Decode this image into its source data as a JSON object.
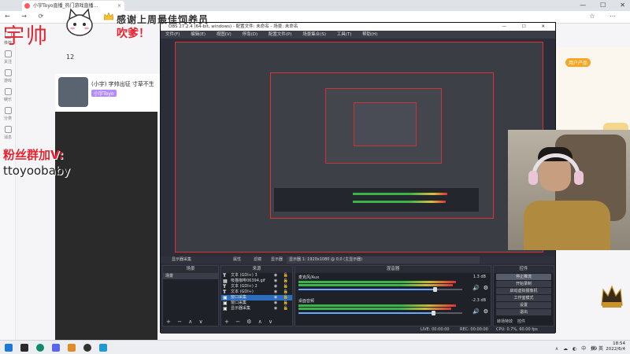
{
  "browser": {
    "tab_title": "小宇Toyo直播_热门游戏直播...",
    "tab_close": "×",
    "window_controls": [
      "—",
      "☐",
      "✕"
    ],
    "nav_glyphs": "← → ⟳",
    "toolbar_glyphs": "☆ ⋯"
  },
  "left_rail": [
    "推荐",
    "关注",
    "游戏",
    "娱乐",
    "分类",
    "消息"
  ],
  "stream": {
    "title": "(小宇) 字帅出征 寸草不生",
    "tag": "小宇Toyo",
    "viewer_count": "12"
  },
  "right_panel": {
    "tag": "用户产品"
  },
  "overlay": {
    "banner_text": "感谢上周最佳饲养员",
    "streamer_name": "宇帅",
    "blow_text": "吹爹！",
    "fans_line1": "粉丝群加V:",
    "fans_line2": "ttoyoobaby"
  },
  "obs": {
    "title": "OBS 27.2.4 (64-bit, windows) - 配置文件: 未命名 - 场景: 未命名",
    "window_buttons": "— ☐ ✕",
    "menu": [
      "文件(F)",
      "编辑(E)",
      "视图(V)",
      "停靠(D)",
      "配置文件(P)",
      "场景集合(S)",
      "工具(T)",
      "帮助(H)"
    ],
    "source_bar": {
      "source_label": "显示器采集",
      "properties": "属性",
      "filters": "滤镜",
      "display": "显示器",
      "display_value": "显示器 1: 1920x1080 @ 0,0 (主显示器)"
    },
    "scenes": {
      "header": "场景",
      "items": [
        "场景"
      ],
      "footer": "+ − ∧ ∨"
    },
    "sources": {
      "header": "来源",
      "items": [
        {
          "type": "T",
          "name": "文本 (GDI+) 3",
          "visibility": "◉ 🔓"
        },
        {
          "type": "▦",
          "name": "吸猫咖啡06394.gif",
          "visibility": "◉ 🔓"
        },
        {
          "type": "T",
          "name": "文本 (GDI+) 2",
          "visibility": "◉ 🔓"
        },
        {
          "type": "T",
          "name": "文本 (GDI+)",
          "visibility": "◉ 🔓"
        },
        {
          "type": "▣",
          "name": "窗口采集",
          "visibility": "◉ 🔓"
        },
        {
          "type": "▣",
          "name": "窗口采集",
          "visibility": "◉ 🔓"
        },
        {
          "type": "▣",
          "name": "显示器采集",
          "visibility": "◉ 🔓"
        }
      ],
      "footer": "+ − ⚙ ∧ ∨"
    },
    "mixer": {
      "header": "混音器",
      "channels": [
        {
          "name": "麦克风/Aux",
          "db": "1.3 dB",
          "level": 0.83
        },
        {
          "name": "桌面音频",
          "db": "-2.3 dB",
          "level": 0.82
        }
      ]
    },
    "controls": {
      "header": "控件",
      "buttons": [
        "停止推流",
        "开始录制",
        "启动虚拟摄像机",
        "工作室模式",
        "设置",
        "退出"
      ],
      "tabs": [
        "转场特效",
        "控件"
      ]
    },
    "status": {
      "live": "LIVE: 00:00:00",
      "rec": "REC: 00:00:00",
      "cpu": "CPU: 0.7%, 60.00 fps"
    }
  },
  "taskbar": {
    "tray_left": "∧ ☁ ◐ 中 拼",
    "time": "18:54",
    "date": "2022/6/4",
    "tray_mid": "69 英"
  },
  "colors": {
    "accent_red": "#e8212e",
    "obs_bg": "#2b2e38",
    "selection_blue": "#2d6fbf"
  }
}
